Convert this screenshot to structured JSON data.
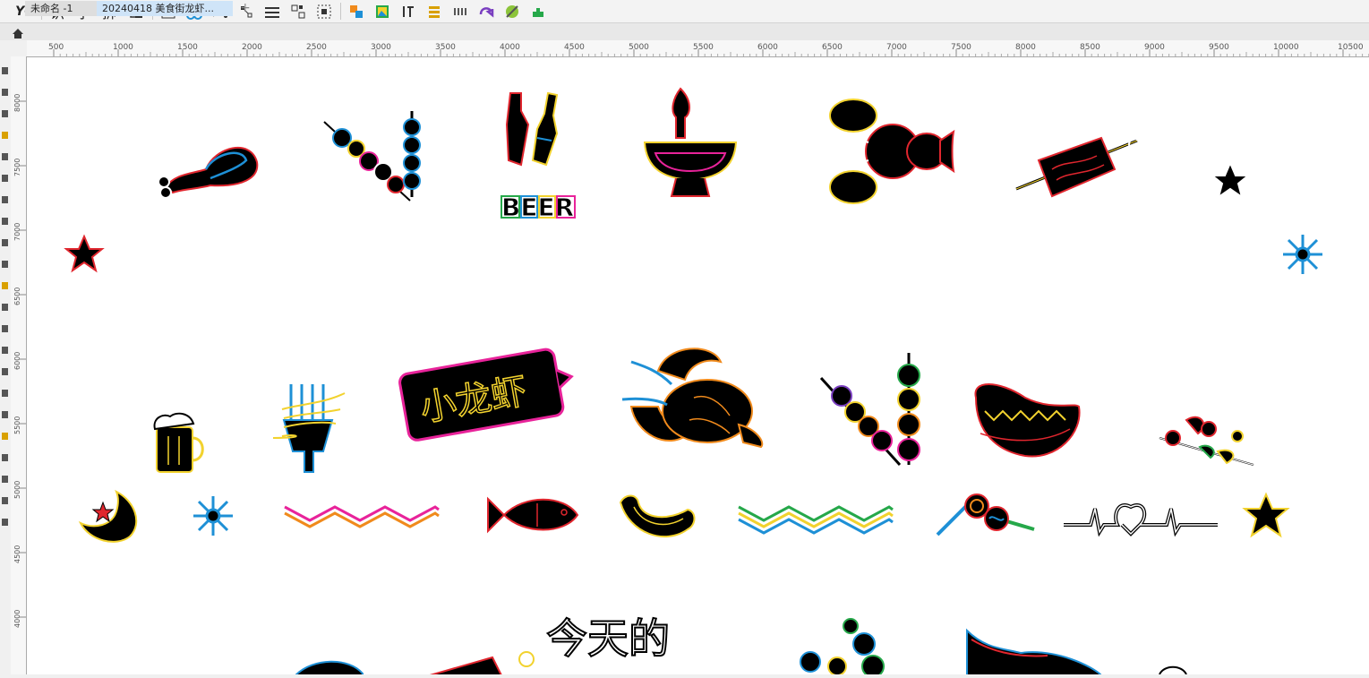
{
  "toolbar": {
    "logo_label": "YG",
    "btn_shi": "识",
    "btn_zi": "字",
    "btn_chai": "拆"
  },
  "tabs": [
    {
      "label": "未命名 -1"
    },
    {
      "label": "20240418 美食街龙虾..."
    }
  ],
  "ruler": {
    "h_ticks": [
      "500",
      "1000",
      "1500",
      "2000",
      "2500",
      "3000",
      "3500",
      "4000",
      "4500",
      "5000",
      "5500",
      "6000",
      "6500",
      "7000",
      "7500",
      "8000",
      "8500",
      "9000",
      "9500",
      "10000",
      "10500"
    ],
    "v_ticks": [
      "8000",
      "7500",
      "7000",
      "6500",
      "6000",
      "5500",
      "5000",
      "4500",
      "4000"
    ]
  },
  "canvas": {
    "beer_text": "BEER",
    "sign_text": "小龙虾",
    "bottom_text": "今天的"
  },
  "colors": {
    "red": "#e0262e",
    "blue": "#1e90d6",
    "yellow": "#f2d22e",
    "orange": "#f08a1c",
    "green": "#26a84a",
    "pink": "#e8239a",
    "white": "#ffffff",
    "purple": "#7a3fc0"
  }
}
